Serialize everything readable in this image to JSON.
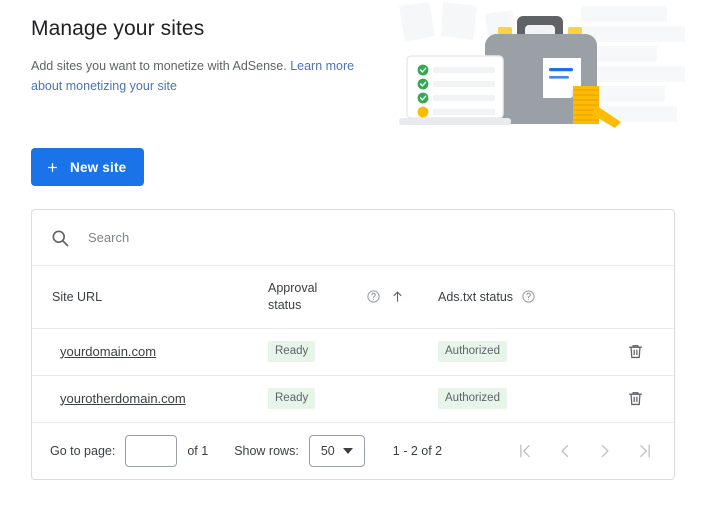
{
  "header": {
    "title": "Manage your sites",
    "subtitle_text": "Add sites you want to monetize with AdSense. ",
    "subtitle_link": "Learn more about monetizing your site"
  },
  "toolbar": {
    "new_site_label": "New site",
    "new_site_icon": "plus-icon",
    "accent_color": "#1a73e8"
  },
  "search": {
    "placeholder": "Search",
    "value": "",
    "icon": "search-icon"
  },
  "table": {
    "columns": [
      {
        "key": "url",
        "label": "Site URL"
      },
      {
        "key": "approval",
        "label": "Approval status",
        "help_icon": "help-circle-icon",
        "sort_icon": "arrow-up-icon",
        "sort_direction": "ascending"
      },
      {
        "key": "adstxt",
        "label": "Ads.txt status",
        "help_icon": "help-circle-icon"
      },
      {
        "key": "actions",
        "label": ""
      }
    ],
    "rows": [
      {
        "url": "yourdomain.com",
        "approval_status": "Ready",
        "adstxt_status": "Authorized",
        "delete_icon": "trash-icon"
      },
      {
        "url": "yourotherdomain.com",
        "approval_status": "Ready",
        "adstxt_status": "Authorized",
        "delete_icon": "trash-icon"
      }
    ],
    "badge_bg": "#e6f4ea"
  },
  "footer": {
    "goto_page_label": "Go to page:",
    "page_value": "",
    "of_total": "of 1",
    "show_rows_label": "Show rows:",
    "rows_per_page": "50",
    "range": "1 - 2 of 2",
    "pager": [
      {
        "name": "first-page",
        "icon": "first-page-icon"
      },
      {
        "name": "previous-page",
        "icon": "chevron-left-icon"
      },
      {
        "name": "next-page",
        "icon": "chevron-right-icon"
      },
      {
        "name": "last-page",
        "icon": "last-page-icon"
      }
    ]
  },
  "illustration": {
    "name": "monetize-briefcase-illustration",
    "elements": [
      "briefcase",
      "checklist-laptop",
      "coin-stack",
      "document-note"
    ]
  }
}
